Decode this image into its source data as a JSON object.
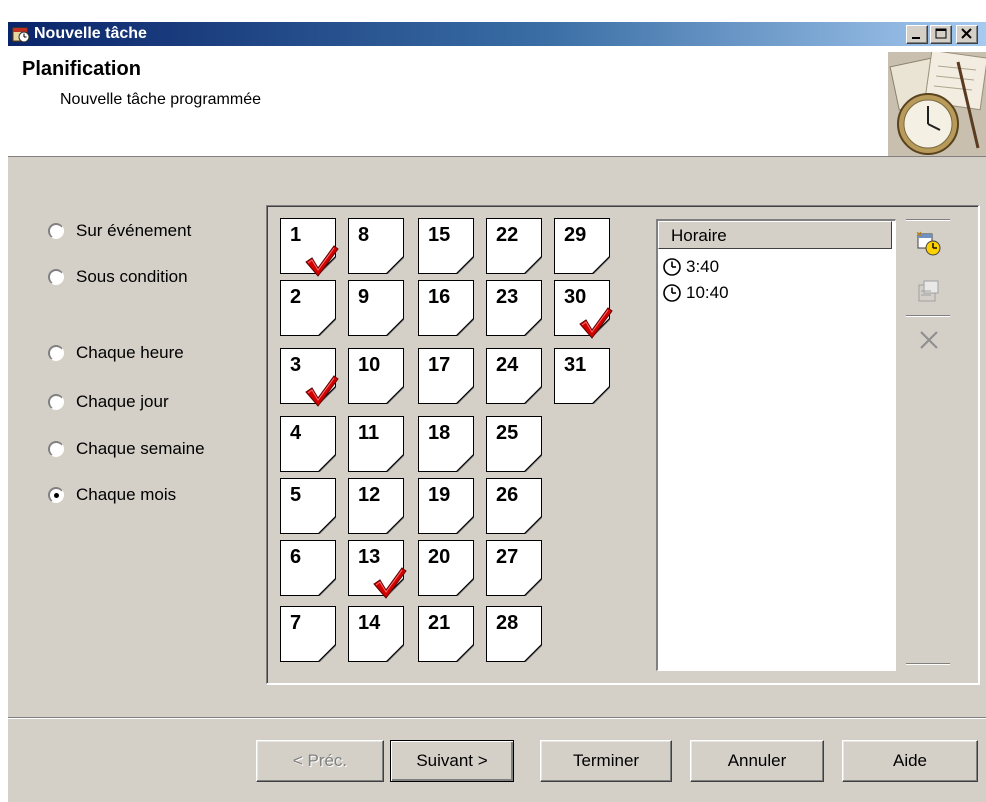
{
  "window": {
    "title": "Nouvelle tâche",
    "title_icon": "scheduler-app-icon",
    "controls": [
      "minimize",
      "maximize",
      "close"
    ]
  },
  "header": {
    "title": "Planification",
    "subtitle": "Nouvelle tâche programmée",
    "art": "clock-and-calendar-illustration"
  },
  "schedule_types": [
    {
      "label": "Sur événement",
      "checked": false
    },
    {
      "label": "Sous condition",
      "checked": false
    },
    {
      "label": "Chaque heure",
      "checked": false
    },
    {
      "label": "Chaque jour",
      "checked": false
    },
    {
      "label": "Chaque semaine",
      "checked": false
    },
    {
      "label": "Chaque mois",
      "checked": true
    }
  ],
  "days": [
    {
      "num": "1",
      "checked": true
    },
    {
      "num": "2",
      "checked": false
    },
    {
      "num": "3",
      "checked": true
    },
    {
      "num": "4",
      "checked": false
    },
    {
      "num": "5",
      "checked": false
    },
    {
      "num": "6",
      "checked": false
    },
    {
      "num": "7",
      "checked": false
    },
    {
      "num": "8",
      "checked": false
    },
    {
      "num": "9",
      "checked": false
    },
    {
      "num": "10",
      "checked": false
    },
    {
      "num": "11",
      "checked": false
    },
    {
      "num": "12",
      "checked": false
    },
    {
      "num": "13",
      "checked": true
    },
    {
      "num": "14",
      "checked": false
    },
    {
      "num": "15",
      "checked": false
    },
    {
      "num": "16",
      "checked": false
    },
    {
      "num": "17",
      "checked": false
    },
    {
      "num": "18",
      "checked": false
    },
    {
      "num": "19",
      "checked": false
    },
    {
      "num": "20",
      "checked": false
    },
    {
      "num": "21",
      "checked": false
    },
    {
      "num": "22",
      "checked": false
    },
    {
      "num": "23",
      "checked": false
    },
    {
      "num": "24",
      "checked": false
    },
    {
      "num": "25",
      "checked": false
    },
    {
      "num": "26",
      "checked": false
    },
    {
      "num": "27",
      "checked": false
    },
    {
      "num": "28",
      "checked": false
    },
    {
      "num": "29",
      "checked": false
    },
    {
      "num": "30",
      "checked": true
    },
    {
      "num": "31",
      "checked": false
    }
  ],
  "times": {
    "header": "Horaire",
    "items": [
      "3:40",
      "10:40"
    ]
  },
  "tools": [
    "add-time-icon",
    "properties-icon",
    "delete-icon"
  ],
  "buttons": {
    "prev": "< Préc.",
    "next": "Suivant >",
    "finish": "Terminer",
    "cancel": "Annuler",
    "help": "Aide"
  },
  "colors": {
    "title_bar_start": "#0a246a",
    "title_bar_end": "#a6caf0",
    "dialog_bg": "#d4d0c8",
    "check_red": "#d40000"
  }
}
